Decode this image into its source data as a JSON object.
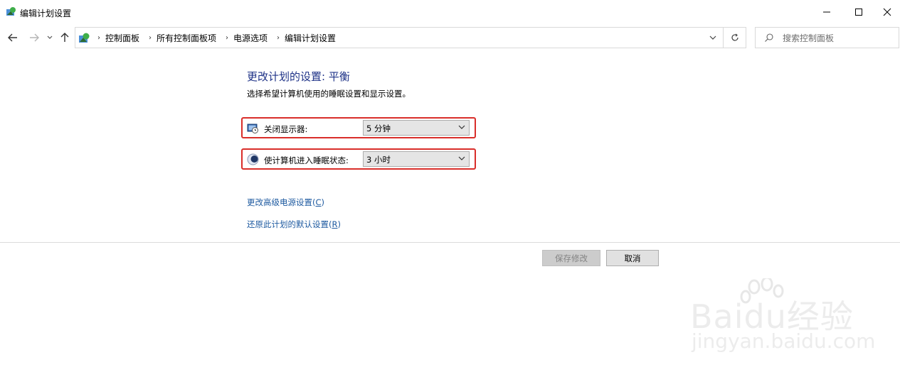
{
  "window": {
    "title": "编辑计划设置",
    "minimize_icon": "minimize-icon",
    "maximize_icon": "maximize-icon",
    "close_icon": "close-icon"
  },
  "nav": {
    "breadcrumbs": [
      "控制面板",
      "所有控制面板项",
      "电源选项",
      "编辑计划设置"
    ],
    "search_placeholder": "搜索控制面板"
  },
  "content": {
    "heading": "更改计划的设置: 平衡",
    "subtitle": "选择希望计算机使用的睡眠设置和显示设置。",
    "settings": [
      {
        "label": "关闭显示器:",
        "value": "5 分钟",
        "icon": "monitor-clock-icon"
      },
      {
        "label": "使计算机进入睡眠状态:",
        "value": "3 小时",
        "icon": "moon-sleep-icon"
      }
    ],
    "links": [
      {
        "text": "更改高级电源设置(",
        "key": "C",
        "close": ")"
      },
      {
        "text": "还原此计划的默认设置(",
        "key": "R",
        "close": ")"
      }
    ],
    "buttons": {
      "save": "保存修改",
      "cancel": "取消"
    }
  },
  "watermark": {
    "brand": "Baidu经验",
    "url": "jingyan.baidu.com"
  },
  "colors": {
    "highlight": "#d92e2a",
    "heading": "#1e3287",
    "link": "#1e5aa0"
  }
}
